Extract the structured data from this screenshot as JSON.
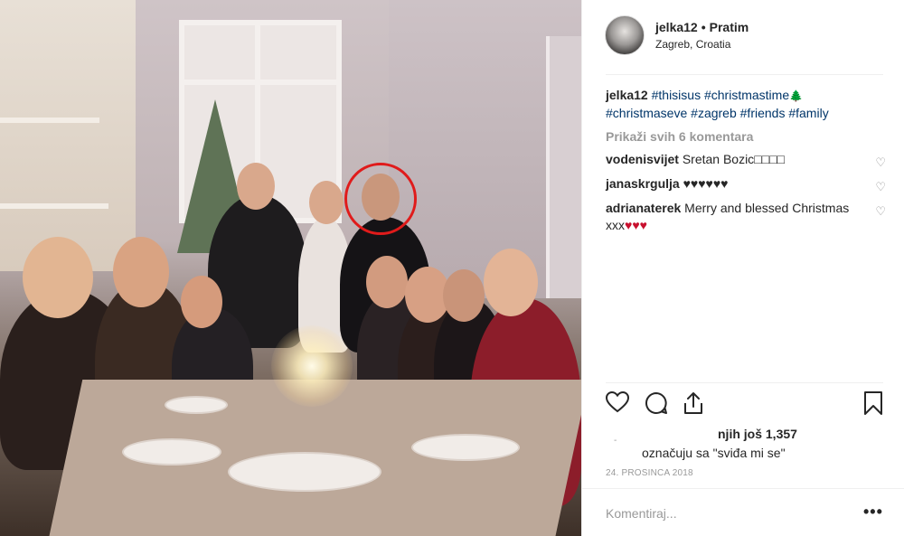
{
  "post": {
    "username": "jelka12",
    "separator": "•",
    "follow_label": "Pratim",
    "location": "Zagreb, Croatia"
  },
  "caption": {
    "username": "jelka12",
    "tags_line1": [
      "#thisisus",
      "#christmastime"
    ],
    "tree_emoji": "🌲",
    "tags_line2": [
      "#christmaseve",
      "#zagreb",
      "#friends",
      "#family"
    ]
  },
  "view_all_comments": "Prikaži svih 6 komentara",
  "comments": [
    {
      "username": "vodenisvijet",
      "text": "Sretan Bozic",
      "suffix": "□□□□"
    },
    {
      "username": "janaskrgulja",
      "text": "♥♥♥♥♥♥",
      "suffix": ""
    },
    {
      "username": "adrianaterek",
      "text": "Merry and blessed Christmas xxx",
      "suffix": "♥♥♥"
    }
  ],
  "likes": {
    "line1": "njih još 1,357",
    "line2": "označuju sa \"sviđa mi se\"",
    "dash": "-"
  },
  "date": "24. PROSINCA 2018",
  "add_comment": {
    "placeholder": "Komentiraj..."
  },
  "more_label": "•••",
  "icons": {
    "like": "heart-icon",
    "comment": "comment-icon",
    "share": "share-icon",
    "save": "bookmark-icon",
    "comment_like": "small-heart-icon"
  },
  "colors": {
    "hashtag": "#003569",
    "muted": "#999999",
    "annotation_circle": "#e01b1b"
  }
}
